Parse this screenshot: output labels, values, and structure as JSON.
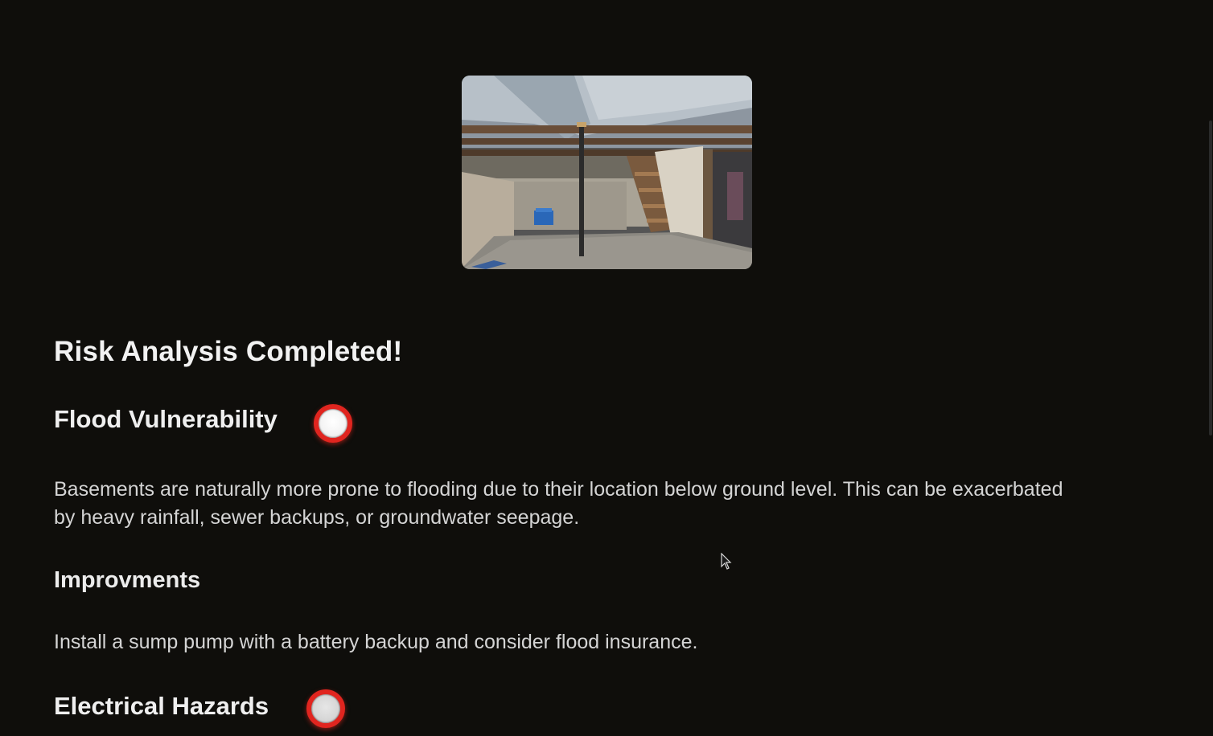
{
  "analysis": {
    "title": "Risk Analysis Completed!",
    "risks": [
      {
        "name": "Flood Vulnerability",
        "description": "Basements are naturally more prone to flooding due to their location below ground level. This can be exacerbated by heavy rainfall, sewer backups, or groundwater seepage.",
        "improvements_heading": "Improvments",
        "improvement": "Install a sump pump with a battery backup and consider flood insurance."
      },
      {
        "name": "Electrical Hazards"
      }
    ]
  },
  "colors": {
    "background": "#0f0e0b",
    "risk_indicator": "#e0251f",
    "text": "#d4d4d4"
  }
}
